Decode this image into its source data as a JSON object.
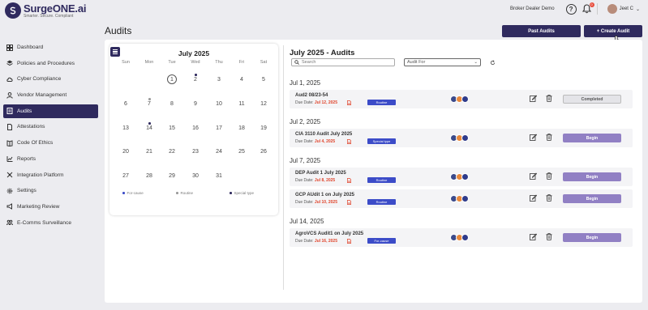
{
  "header": {
    "logo_name": "SurgeONE.ai",
    "logo_tagline": "Smarter. Secure. Compliant",
    "tenant": "Broker Dealer Demo",
    "help_icon": "question-circle-icon",
    "notification_count": "0",
    "user_name": "Jeet C"
  },
  "sidebar": {
    "items": [
      {
        "label": "Dashboard",
        "icon": "dashboard-icon"
      },
      {
        "label": "Policies and Procedures",
        "icon": "layers-icon"
      },
      {
        "label": "Cyber Compliance",
        "icon": "cloud-icon"
      },
      {
        "label": "Vendor Management",
        "icon": "person-icon"
      },
      {
        "label": "Audits",
        "icon": "audit-icon",
        "active": true
      },
      {
        "label": "Attestations",
        "icon": "document-icon"
      },
      {
        "label": "Code Of Ethics",
        "icon": "book-icon"
      },
      {
        "label": "Reports",
        "icon": "chart-icon"
      },
      {
        "label": "Integration Platform",
        "icon": "integration-icon"
      },
      {
        "label": "Settings",
        "icon": "gear-icon"
      },
      {
        "label": "Marketing Review",
        "icon": "megaphone-icon"
      },
      {
        "label": "E-Comms Surveillance",
        "icon": "group-icon"
      }
    ]
  },
  "page": {
    "title": "Audits",
    "past_audits_label": "Past Audits",
    "create_audit_label": "+ Create Audit"
  },
  "calendar": {
    "title": "July 2025",
    "weekdays": [
      "Sun",
      "Mon",
      "Tue",
      "Wed",
      "Thu",
      "Fri",
      "Sat"
    ],
    "weeks": [
      [
        "",
        "",
        "1",
        "2",
        "3",
        "4",
        "5"
      ],
      [
        "6",
        "7",
        "8",
        "9",
        "10",
        "11",
        "12"
      ],
      [
        "13",
        "14",
        "15",
        "16",
        "17",
        "18",
        "19"
      ],
      [
        "20",
        "21",
        "22",
        "23",
        "24",
        "25",
        "26"
      ],
      [
        "27",
        "28",
        "29",
        "30",
        "31",
        "",
        ""
      ]
    ],
    "today": "1",
    "legend": {
      "for_cause": "For-cause",
      "routine": "Routine",
      "special_type": "Special type"
    },
    "colors": {
      "for_cause": "#3c4cc8",
      "routine": "#9a9a9a",
      "special_type": "#2f2a5e"
    }
  },
  "audits": {
    "title": "July 2025 - Audits",
    "search_placeholder": "Search",
    "filter_label": "Audit For",
    "due_prefix": "Due Date:",
    "groups": [
      {
        "date": "Jul 1, 2025",
        "items": [
          {
            "name": "Aud2 08/23-54",
            "due": "Jul 12, 2025",
            "tag": "Routine",
            "status": "Completed"
          }
        ]
      },
      {
        "date": "Jul 2, 2025",
        "items": [
          {
            "name": "CIA 3110 Audit July 2025",
            "due": "Jul 4, 2025",
            "tag": "Special type",
            "status": "Begin"
          }
        ]
      },
      {
        "date": "Jul 7, 2025",
        "items": [
          {
            "name": "DEP Audit 1 July 2025",
            "due": "Jul 8, 2025",
            "tag": "Routine",
            "status": "Begin"
          },
          {
            "name": "GCP AUdit 1 on July 2025",
            "due": "Jul 10, 2025",
            "tag": "Routine",
            "status": "Begin"
          }
        ]
      },
      {
        "date": "Jul 14, 2025",
        "items": [
          {
            "name": "AgroVCS Audit1 on July 2025",
            "due": "Jul 16, 2025",
            "tag": "For-cause",
            "status": "Begin"
          }
        ]
      }
    ]
  },
  "colors": {
    "brand": "#2f2a5e",
    "tag_blue": "#3c4cc8",
    "begin_purple": "#9180c4",
    "due_red": "#e0452c"
  }
}
